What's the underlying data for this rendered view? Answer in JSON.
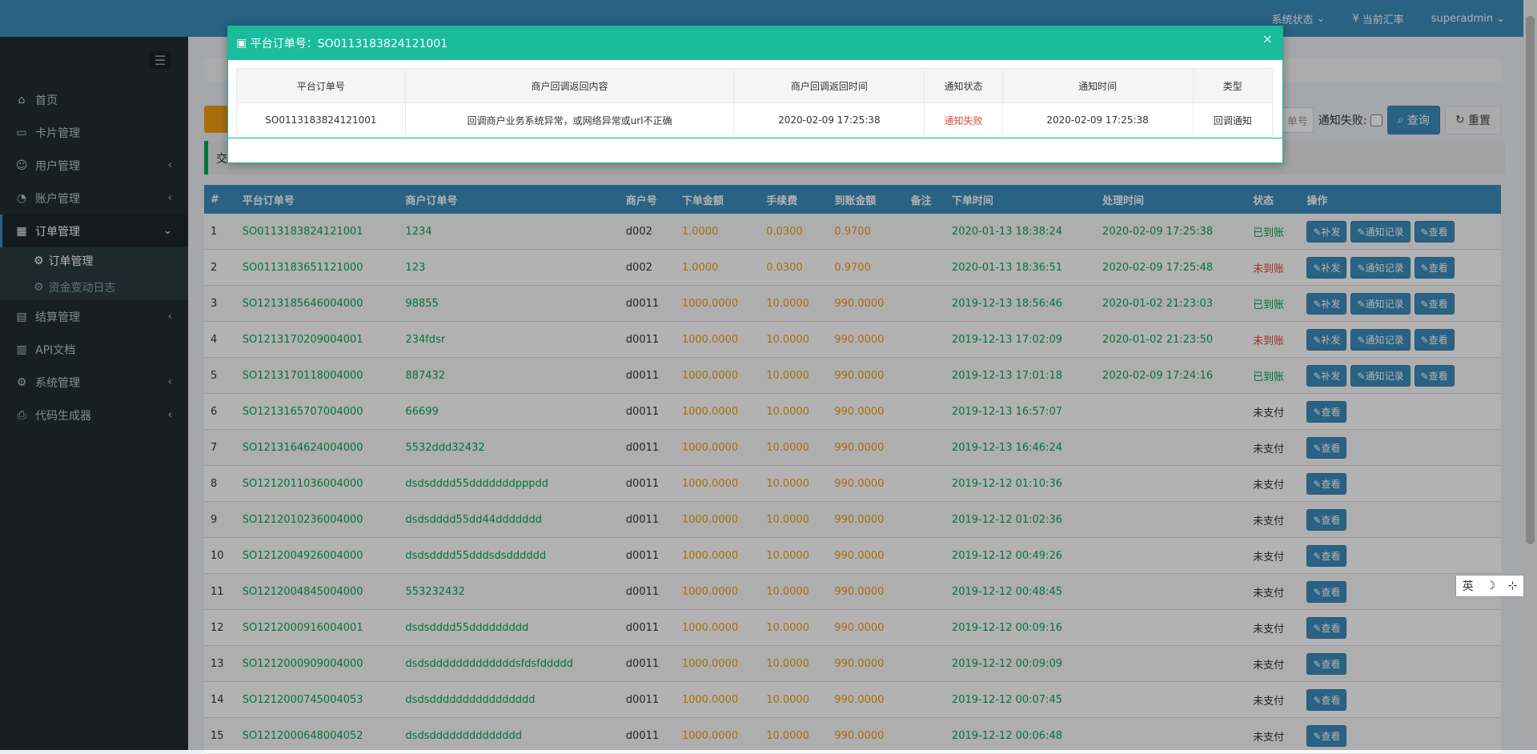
{
  "topbar": {
    "items": [
      "系统状态",
      "当前汇率",
      "superadmin"
    ],
    "rate_icon": "¥"
  },
  "sidebar": {
    "items": [
      {
        "label": "首页",
        "icon": "home-icon"
      },
      {
        "label": "卡片管理",
        "icon": "card-icon"
      },
      {
        "label": "用户管理",
        "icon": "users-icon"
      },
      {
        "label": "账户管理",
        "icon": "account-icon"
      },
      {
        "label": "订单管理",
        "icon": "order-icon"
      },
      {
        "label": "结算管理",
        "icon": "settle-icon"
      },
      {
        "label": "API文档",
        "icon": "doc-icon"
      },
      {
        "label": "系统管理",
        "icon": "gear-icon"
      },
      {
        "label": "代码生成器",
        "icon": "print-icon"
      }
    ],
    "subitems": [
      "订单管理",
      "资金变动日志"
    ]
  },
  "toolbar": {
    "input_hint": "单号",
    "notify_fail_label": "通知失败:",
    "search_label": "查询",
    "reset_label": "重置"
  },
  "callout": {
    "text": "交"
  },
  "table": {
    "headers": [
      "#",
      "平台订单号",
      "商户订单号",
      "商户号",
      "下单金额",
      "手续费",
      "到账金额",
      "备注",
      "下单时间",
      "处理时间",
      "状态",
      "操作"
    ],
    "rows": [
      {
        "n": "1",
        "plat": "SO0113183824121001",
        "merch": "1234",
        "mid": "d002",
        "amt": "1.0000",
        "fee": "0.0300",
        "net": "0.9700",
        "note": "",
        "ctime": "2020-01-13 18:38:24",
        "ptime": "2020-02-09 17:25:38",
        "status": "已到账",
        "status_color": "#00a65a"
      },
      {
        "n": "2",
        "plat": "SO0113183651121000",
        "merch": "123",
        "mid": "d002",
        "amt": "1.0000",
        "fee": "0.0300",
        "net": "0.9700",
        "note": "",
        "ctime": "2020-01-13 18:36:51",
        "ptime": "2020-02-09 17:25:48",
        "status": "未到账",
        "status_color": "#dd4b39"
      },
      {
        "n": "3",
        "plat": "SO1213185646004000",
        "merch": "98855",
        "mid": "d0011",
        "amt": "1000.0000",
        "fee": "10.0000",
        "net": "990.0000",
        "note": "",
        "ctime": "2019-12-13 18:56:46",
        "ptime": "2020-01-02 21:23:03",
        "status": "已到账",
        "status_color": "#00a65a"
      },
      {
        "n": "4",
        "plat": "SO1213170209004001",
        "merch": "234fdsr",
        "mid": "d0011",
        "amt": "1000.0000",
        "fee": "10.0000",
        "net": "990.0000",
        "note": "",
        "ctime": "2019-12-13 17:02:09",
        "ptime": "2020-01-02 21:23:50",
        "status": "未到账",
        "status_color": "#dd4b39"
      },
      {
        "n": "5",
        "plat": "SO1213170118004000",
        "merch": "887432",
        "mid": "d0011",
        "amt": "1000.0000",
        "fee": "10.0000",
        "net": "990.0000",
        "note": "",
        "ctime": "2019-12-13 17:01:18",
        "ptime": "2020-02-09 17:24:16",
        "status": "已到账",
        "status_color": "#00a65a"
      },
      {
        "n": "6",
        "plat": "SO1213165707004000",
        "merch": "66699",
        "mid": "d0011",
        "amt": "1000.0000",
        "fee": "10.0000",
        "net": "990.0000",
        "note": "",
        "ctime": "2019-12-13 16:57:07",
        "ptime": "",
        "status": "未支付",
        "status_color": "#333333"
      },
      {
        "n": "7",
        "plat": "SO1213164624004000",
        "merch": "5532ddd32432",
        "mid": "d0011",
        "amt": "1000.0000",
        "fee": "10.0000",
        "net": "990.0000",
        "note": "",
        "ctime": "2019-12-13 16:46:24",
        "ptime": "",
        "status": "未支付",
        "status_color": "#333333"
      },
      {
        "n": "8",
        "plat": "SO1212011036004000",
        "merch": "dsdsdddd55dddddddpppdd",
        "mid": "d0011",
        "amt": "1000.0000",
        "fee": "10.0000",
        "net": "990.0000",
        "note": "",
        "ctime": "2019-12-12 01:10:36",
        "ptime": "",
        "status": "未支付",
        "status_color": "#333333"
      },
      {
        "n": "9",
        "plat": "SO1212010236004000",
        "merch": "dsdsdddd55dd44ddddddd",
        "mid": "d0011",
        "amt": "1000.0000",
        "fee": "10.0000",
        "net": "990.0000",
        "note": "",
        "ctime": "2019-12-12 01:02:36",
        "ptime": "",
        "status": "未支付",
        "status_color": "#333333"
      },
      {
        "n": "10",
        "plat": "SO1212004926004000",
        "merch": "dsdsdddd55dddsdsdddddd",
        "mid": "d0011",
        "amt": "1000.0000",
        "fee": "10.0000",
        "net": "990.0000",
        "note": "",
        "ctime": "2019-12-12 00:49:26",
        "ptime": "",
        "status": "未支付",
        "status_color": "#333333"
      },
      {
        "n": "11",
        "plat": "SO1212004845004000",
        "merch": "553232432",
        "mid": "d0011",
        "amt": "1000.0000",
        "fee": "10.0000",
        "net": "990.0000",
        "note": "",
        "ctime": "2019-12-12 00:48:45",
        "ptime": "",
        "status": "未支付",
        "status_color": "#333333"
      },
      {
        "n": "12",
        "plat": "SO1212000916004001",
        "merch": "dsdsdddd55ddddddddd",
        "mid": "d0011",
        "amt": "1000.0000",
        "fee": "10.0000",
        "net": "990.0000",
        "note": "",
        "ctime": "2019-12-12 00:09:16",
        "ptime": "",
        "status": "未支付",
        "status_color": "#333333"
      },
      {
        "n": "13",
        "plat": "SO1212000909004000",
        "merch": "dsdsdddddddddddddsfdsfddddd",
        "mid": "d0011",
        "amt": "1000.0000",
        "fee": "10.0000",
        "net": "990.0000",
        "note": "",
        "ctime": "2019-12-12 00:09:09",
        "ptime": "",
        "status": "未支付",
        "status_color": "#333333"
      },
      {
        "n": "14",
        "plat": "SO1212000745004053",
        "merch": "dsdsdddddddddddddddd",
        "mid": "d0011",
        "amt": "1000.0000",
        "fee": "10.0000",
        "net": "990.0000",
        "note": "",
        "ctime": "2019-12-12 00:07:45",
        "ptime": "",
        "status": "未支付",
        "status_color": "#333333"
      },
      {
        "n": "15",
        "plat": "SO1212000648004052",
        "merch": "dsdsdddddddddddddd",
        "mid": "d0011",
        "amt": "1000.0000",
        "fee": "10.0000",
        "net": "990.0000",
        "note": "",
        "ctime": "2019-12-12 00:06:48",
        "ptime": "",
        "status": "未支付",
        "status_color": "#333333"
      }
    ],
    "action_labels": {
      "reissue": "补发",
      "notify_log": "通知记录",
      "view": "查看"
    }
  },
  "modal": {
    "title": "平台订单号：SO0113183824121001",
    "close_glyph": "×",
    "headers": [
      "平台订单号",
      "商户回调返回内容",
      "商户回调返回时间",
      "通知状态",
      "通知时间",
      "类型"
    ],
    "row": {
      "order_no": "SO0113183824121001",
      "content": "回调商户业务系统异常，或网络异常或url不正确",
      "return_time": "2020-02-09 17:25:38",
      "status": "通知失败",
      "notify_time": "2020-02-09 17:25:38",
      "type": "回调通知"
    }
  },
  "ime": {
    "items": [
      "英",
      "☽",
      "⊹"
    ]
  },
  "colors": {
    "accent": "#3c8dbc",
    "modal": "#1abc9c",
    "success": "#00a65a",
    "danger": "#dd4b39",
    "amount": "#f39c12"
  }
}
